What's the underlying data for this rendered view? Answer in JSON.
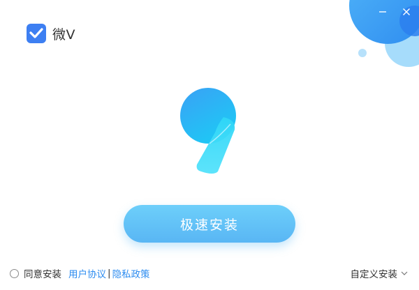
{
  "app": {
    "name": "微V"
  },
  "window_controls": {
    "minimize": "minimize-icon",
    "close": "close-icon"
  },
  "main": {
    "install_button_label": "极速安装"
  },
  "footer": {
    "agree_label": "同意安装",
    "user_agreement_link": "用户协议",
    "separator": "|",
    "privacy_link": "隐私政策",
    "custom_install_label": "自定义安装"
  },
  "colors": {
    "accent": "#2d8cf0",
    "button": "#5fc0f7",
    "logo_blue": "#3d7ff2"
  }
}
